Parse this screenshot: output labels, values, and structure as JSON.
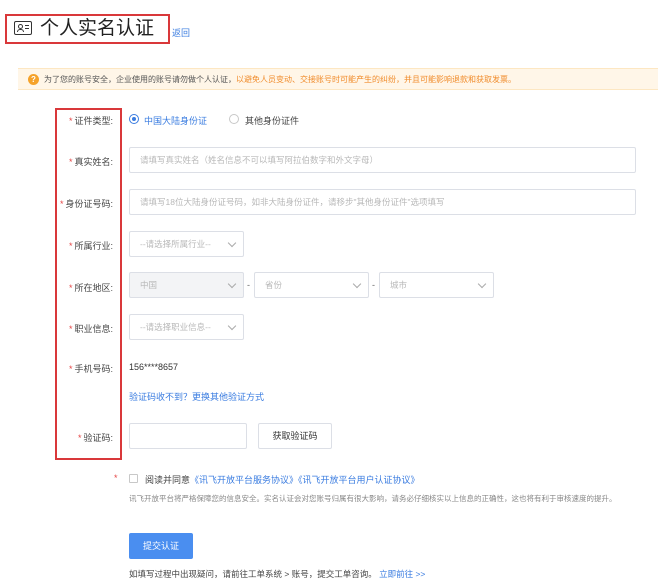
{
  "header": {
    "title": "个人实名认证",
    "back_label": "返回"
  },
  "notice": {
    "icon": "?",
    "text": "为了您的账号安全，企业使用的账号请勿做个人认证，",
    "warning": "以避免人员变动、交接账号时可能产生的纠纷，并且可能影响退款和获取发票。"
  },
  "form": {
    "id_type": {
      "label": "证件类型:",
      "options": [
        "中国大陆身份证",
        "其他身份证件"
      ],
      "selected": "中国大陆身份证"
    },
    "real_name": {
      "label": "真实姓名:",
      "placeholder": "请填写真实姓名（姓名信息不可以填写阿拉伯数字和外文字母）"
    },
    "id_number": {
      "label": "身份证号码:",
      "placeholder": "请填写18位大陆身份证号码，如非大陆身份证件，请移步\"其他身份证件\"选项填写"
    },
    "industry": {
      "label": "所属行业:",
      "placeholder": "--请选择所属行业--"
    },
    "region": {
      "label": "所在地区:",
      "country": "中国",
      "province": "省份",
      "city": "城市",
      "separator": "-"
    },
    "occupation": {
      "label": "职业信息:",
      "placeholder": "--请选择职业信息--"
    },
    "phone": {
      "label": "手机号码:",
      "value": "156****8657",
      "alt_link": "验证码收不到？更换其他验证方式"
    },
    "code": {
      "label": "验证码:",
      "button": "获取验证码"
    },
    "required_mark": "*"
  },
  "agreement": {
    "prefix": "阅读并同意",
    "link1": "《讯飞开放平台服务协议》",
    "link2": "《讯飞开放平台用户认证协议》",
    "info": "讯飞开放平台将严格保障您的信息安全。实名认证会对您账号归属有很大影响，请务必仔细核实以上信息的正确性，这也将有利于审核速度的提升。"
  },
  "submit_label": "提交认证",
  "footer": {
    "text": "如填写过程中出现疑问，请前往工单系统 > 账号，提交工单咨询。",
    "link": "立即前往 >>"
  },
  "colors": {
    "accent": "#3a7ce0",
    "primary_button": "#4a8ef0",
    "highlight_border": "#d9383a",
    "warning": "#f08c2c",
    "required": "#e54545"
  }
}
